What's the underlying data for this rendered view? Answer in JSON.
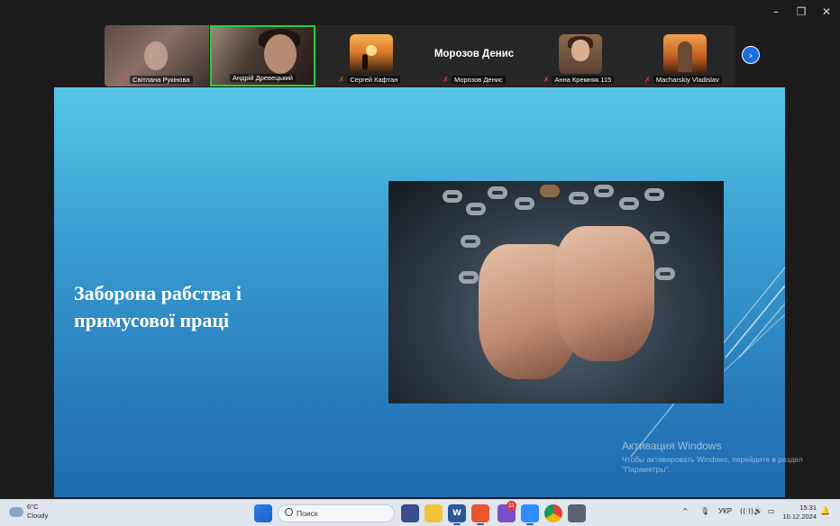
{
  "window_controls": {
    "minimize": "–",
    "maximize": "❐",
    "close": "✕"
  },
  "participants": [
    {
      "name": "Світлана Рукінова"
    },
    {
      "name": "Андрій Древецький"
    },
    {
      "name": "Сергей Кафтан"
    },
    {
      "name": "Морозов Денис",
      "display_name": "Морозов Денис"
    },
    {
      "name": "Анна Кремняк 115"
    },
    {
      "name": "Macharskiy Vladislav"
    }
  ],
  "mic_muted_glyph": "✗",
  "next_button_glyph": "›",
  "slide": {
    "title": "Заборона рабства і\nпримусової праці"
  },
  "watermark": {
    "title": "Активация Windows",
    "subtitle": "Чтобы активировать Windows, перейдите в раздел \"Параметры\"."
  },
  "taskbar": {
    "weather_temp": "6°C",
    "weather_desc": "Cloudy",
    "search_placeholder": "Поиск",
    "word_label": "W",
    "notif_badge": "11",
    "tray_up": "^",
    "tray_mic": "🎙",
    "lang": "УКР",
    "tray_wifi": "((·))",
    "tray_vol": "🔊",
    "tray_bat": "▭",
    "time": "15:31",
    "date": "10.12.2024",
    "bell": "🔔"
  },
  "colors": {
    "active_speaker_border": "#2ecc40",
    "slide_top": "#58c6e8",
    "slide_bottom": "#1e6bb0",
    "accent": "#1a6ee0"
  }
}
